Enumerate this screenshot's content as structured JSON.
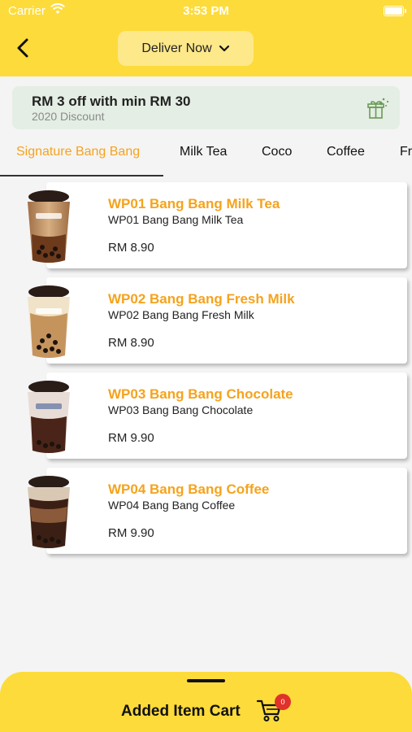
{
  "status_bar": {
    "carrier": "Carrier",
    "time": "3:53 PM"
  },
  "header": {
    "deliver_label": "Deliver Now"
  },
  "promo": {
    "title": "RM 3 off with min RM 30",
    "subtitle": "2020 Discount"
  },
  "tabs": [
    {
      "label": "Signature Bang Bang",
      "active": true
    },
    {
      "label": "Milk Tea"
    },
    {
      "label": "Coco"
    },
    {
      "label": "Coffee"
    },
    {
      "label": "Fr"
    }
  ],
  "products": [
    {
      "name": "WP01 Bang Bang Milk Tea",
      "description": "WP01 Bang Bang Milk Tea",
      "price": "RM 8.90",
      "drink": "milk-tea"
    },
    {
      "name": "WP02 Bang Bang Fresh Milk",
      "description": "WP02 Bang Bang Fresh Milk",
      "price": "RM 8.90",
      "drink": "fresh-milk"
    },
    {
      "name": "WP03 Bang Bang Chocolate",
      "description": "WP03 Bang Bang Chocolate",
      "price": "RM 9.90",
      "drink": "chocolate"
    },
    {
      "name": "WP04 Bang Bang Coffee",
      "description": "WP04 Bang Bang Coffee",
      "price": "RM 9.90",
      "drink": "coffee"
    }
  ],
  "cart": {
    "label": "Added Item Cart",
    "count": "0"
  },
  "colors": {
    "brand_yellow": "#fddb3a",
    "accent_orange": "#f5a31d",
    "badge_red": "#e0322a",
    "promo_bg": "#e4eee4"
  },
  "icons": [
    "wifi-icon",
    "battery-icon",
    "back-chevron-icon",
    "chevron-down-icon",
    "gift-icon",
    "cart-icon"
  ]
}
